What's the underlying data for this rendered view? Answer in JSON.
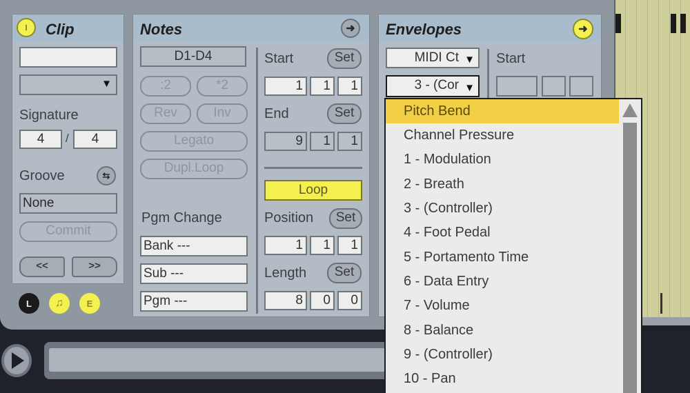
{
  "clip": {
    "title": "Clip",
    "name_value": "",
    "color_select_value": "",
    "signature_label": "Signature",
    "signature_num": "4",
    "signature_sep": "/",
    "signature_den": "4",
    "groove_label": "Groove",
    "groove_value": "None",
    "commit_label": "Commit",
    "prev_label": "<<",
    "next_label": ">>",
    "view_buttons": [
      "L",
      "♫",
      "E"
    ]
  },
  "notes": {
    "title": "Notes",
    "range_value": "D1-D4",
    "half_label": ":2",
    "double_label": "*2",
    "rev_label": "Rev",
    "inv_label": "Inv",
    "legato_label": "Legato",
    "dupl_label": "Dupl.Loop",
    "pgm_change_label": "Pgm Change",
    "bank_value": "Bank ---",
    "sub_value": "Sub ---",
    "pgm_value": "Pgm ---",
    "start_label": "Start",
    "end_label": "End",
    "set_label": "Set",
    "start_values": [
      "1",
      "1",
      "1"
    ],
    "end_values": [
      "9",
      "1",
      "1"
    ],
    "loop_label": "Loop",
    "position_label": "Position",
    "position_values": [
      "1",
      "1",
      "1"
    ],
    "length_label": "Length",
    "length_values": [
      "8",
      "0",
      "0"
    ]
  },
  "envelopes": {
    "title": "Envelopes",
    "device_select": "MIDI Ct",
    "control_select": "3 - (Cor",
    "start_label": "Start",
    "dropdown_items": [
      "Pitch Bend",
      "Channel Pressure",
      "1 - Modulation",
      "2 - Breath",
      "3 - (Controller)",
      "4 - Foot Pedal",
      "5 - Portamento Time",
      "6 - Data Entry",
      "7 - Volume",
      "8 - Balance",
      "9 - (Controller)",
      "10 - Pan"
    ],
    "highlighted_item": "Pitch Bend"
  },
  "colors": {
    "accent_yellow": "#f3f050",
    "highlight": "#f2cf45",
    "panel": "#b3bcc5"
  }
}
